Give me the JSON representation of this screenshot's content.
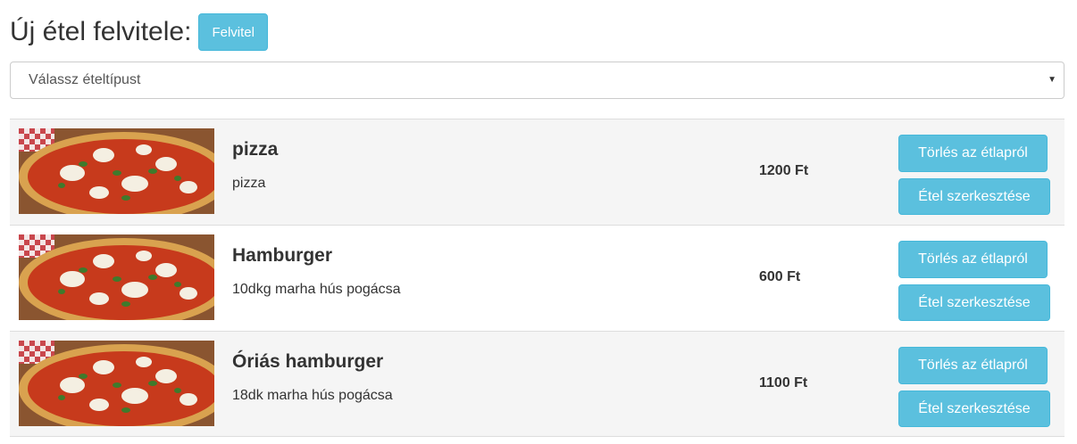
{
  "header": {
    "title": "Új étel felvitele:",
    "add_label": "Felvitel"
  },
  "filter": {
    "selected": "Válassz ételtípust",
    "arrow_icon": "caret-down-icon"
  },
  "colors": {
    "button_info": "#5bc0de",
    "row_striped": "#f5f5f5"
  },
  "foods": [
    {
      "name": "pizza",
      "description": "pizza",
      "price": "1200 Ft",
      "delete_label": "Törlés az étlapról",
      "edit_label": "Étel szerkesztése",
      "image": "pizza-photo"
    },
    {
      "name": "Hamburger",
      "description": "10dkg marha hús pogácsa",
      "price": "600 Ft",
      "delete_label": "Törlés az étlapról",
      "edit_label": "Étel szerkesztése",
      "image": "pizza-photo"
    },
    {
      "name": "Óriás hamburger",
      "description": "18dk marha hús pogácsa",
      "price": "1100 Ft",
      "delete_label": "Törlés az étlapról",
      "edit_label": "Étel szerkesztése",
      "image": "pizza-photo"
    }
  ]
}
